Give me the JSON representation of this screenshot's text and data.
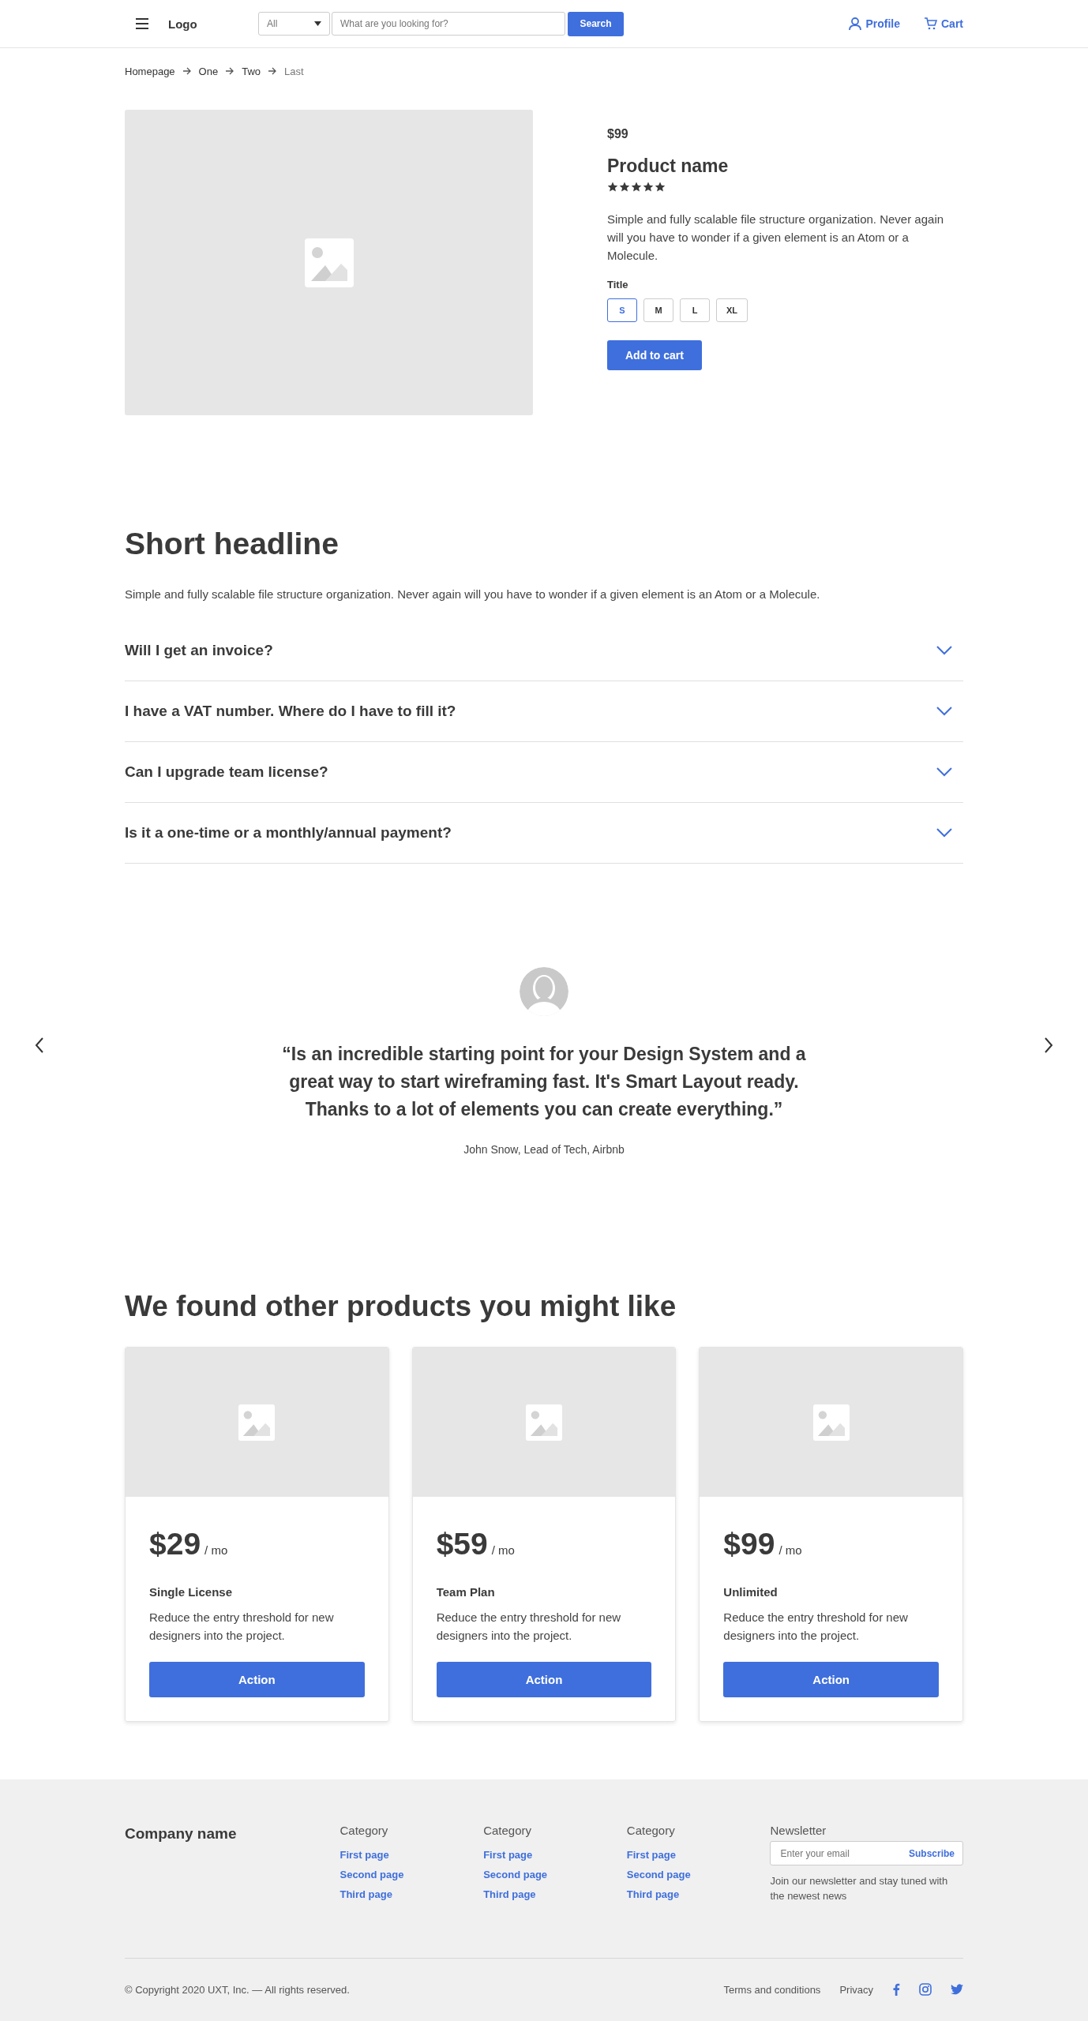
{
  "header": {
    "logo": "Logo",
    "category_select": "All",
    "search": {
      "placeholder": "What are you looking for?"
    },
    "search_button": "Search",
    "profile": "Profile",
    "cart": "Cart"
  },
  "breadcrumb": [
    "Homepage",
    "One",
    "Two",
    "Last"
  ],
  "product": {
    "price": "$99",
    "name": "Product name",
    "stars": 5,
    "description": "Simple and fully scalable file structure organization. Never again will you have to wonder if a given element is an Atom or a Molecule.",
    "option_title": "Title",
    "sizes": [
      {
        "label": "S",
        "selected": true
      },
      {
        "label": "M",
        "selected": false
      },
      {
        "label": "L",
        "selected": false
      },
      {
        "label": "XL",
        "selected": false
      }
    ],
    "add_button": "Add to cart"
  },
  "faq": {
    "headline": "Short headline",
    "intro": "Simple and fully scalable file structure organization. Never again will you have to wonder if a given element is an Atom or a Molecule.",
    "items": [
      {
        "question": "Will I get an invoice?",
        "expanded": false
      },
      {
        "question": "I have a VAT number. Where do I have to fill it?",
        "expanded": false
      },
      {
        "question": "Can I upgrade team license?",
        "expanded": false
      },
      {
        "question": "Is it a one-time or a monthly/annual payment?",
        "expanded": false
      }
    ]
  },
  "testimonial": {
    "quote": "“Is an incredible starting point for your Design System and a great way to start wireframing fast. It's Smart Layout ready. Thanks to a lot of elements you can create everything.”",
    "author": "John Snow, Lead of Tech, Airbnb"
  },
  "related": {
    "headline": "We found other products you might like",
    "cards": [
      {
        "price": "$29",
        "period": "/ mo",
        "title": "Single License",
        "text": "Reduce the entry threshold for new designers into the project.",
        "button": "Action"
      },
      {
        "price": "$59",
        "period": "/ mo",
        "title": "Team Plan",
        "text": "Reduce the entry threshold for new designers into the project.",
        "button": "Action"
      },
      {
        "price": "$99",
        "period": "/ mo",
        "title": "Unlimited",
        "text": "Reduce the entry threshold for new designers into the project.",
        "button": "Action"
      }
    ]
  },
  "footer": {
    "company": "Company name",
    "columns": [
      {
        "title": "Category",
        "links": [
          "First page",
          "Second page",
          "Third page"
        ]
      },
      {
        "title": "Category",
        "links": [
          "First page",
          "Second page",
          "Third page"
        ]
      },
      {
        "title": "Category",
        "links": [
          "First page",
          "Second page",
          "Third page"
        ]
      }
    ],
    "newsletter": {
      "title": "Newsletter",
      "email": {
        "placeholder": "Enter your email"
      },
      "button": "Subscribe",
      "note": "Join our newsletter and stay tuned with the newest news"
    },
    "copyright": "© Copyright 2020 UXT, Inc. — All rights reserved.",
    "links": [
      "Terms and conditions",
      "Privacy"
    ]
  }
}
